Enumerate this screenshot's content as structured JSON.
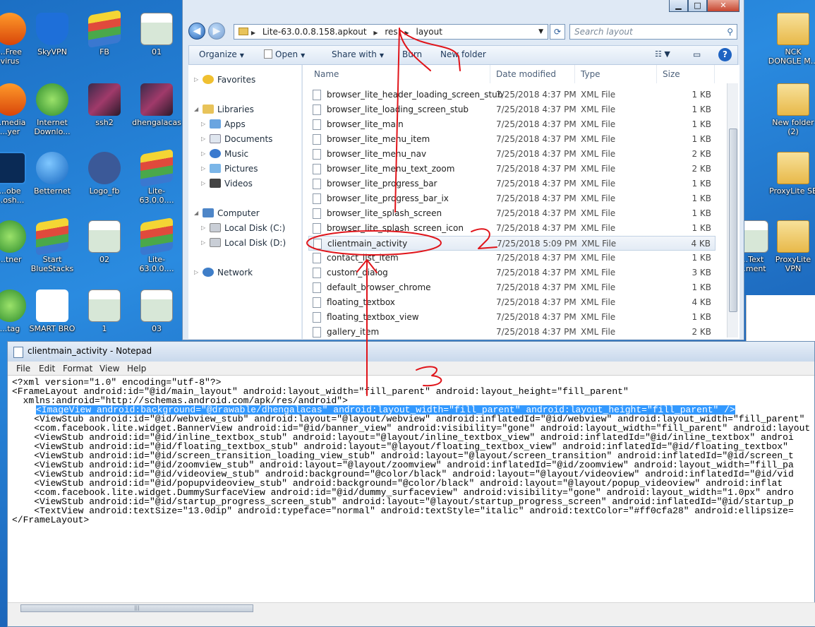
{
  "desktop": {
    "icons": [
      {
        "label": "...Free\nvirus",
        "icon": "antivirus-icon"
      },
      {
        "label": "SkyVPN",
        "icon": "vpn-shield-icon"
      },
      {
        "label": "FB",
        "icon": "bluestacks-icon"
      },
      {
        "label": "01",
        "icon": "screenshot-icon"
      },
      {
        "label": "...media\n...yer",
        "icon": "vlc-icon"
      },
      {
        "label": "Internet\nDownlo...",
        "icon": "idm-icon"
      },
      {
        "label": "ssh2",
        "icon": "photo-icon"
      },
      {
        "label": "dhengalacas",
        "icon": "photo-icon"
      },
      {
        "label": "...obe\n...osh...",
        "icon": "photoshop-icon"
      },
      {
        "label": "Betternet",
        "icon": "betternet-icon"
      },
      {
        "label": "Logo_fb",
        "icon": "facebook-icon"
      },
      {
        "label": "Lite-63.0.0....",
        "icon": "bluestacks-icon"
      },
      {
        "label": "...tner",
        "icon": "app-icon"
      },
      {
        "label": "Start\nBlueStacks",
        "icon": "bluestacks-icon"
      },
      {
        "label": "02",
        "icon": "screenshot-icon"
      },
      {
        "label": "Lite-63.0.0....",
        "icon": "bluestacks-icon"
      },
      {
        "label": "...tag",
        "icon": "app-icon"
      },
      {
        "label": "SMART BRO",
        "icon": "smartbro-icon"
      },
      {
        "label": "1",
        "icon": "screenshot-icon"
      },
      {
        "label": "03",
        "icon": "screenshot-icon"
      },
      {
        "label": "NCK\nDONGLE M...",
        "icon": "folder-icon"
      },
      {
        "label": "New folder\n(2)",
        "icon": "folder-icon"
      },
      {
        "label": "ProxyLite SE",
        "icon": "folder-icon"
      },
      {
        "label": "ProxyLite\nVPN",
        "icon": "folder-icon"
      },
      {
        "label": "...Text\n...ment",
        "icon": "text-icon"
      }
    ]
  },
  "explorer": {
    "window_controls": {
      "minimize": "▁",
      "maximize": "□",
      "close": "✕"
    },
    "breadcrumb": [
      "Lite-63.0.0.8.158.apkout",
      "res",
      "layout"
    ],
    "search_placeholder": "Search layout",
    "toolbar": {
      "organize": "Organize",
      "open": "Open",
      "share_with": "Share with",
      "burn": "Burn",
      "new_folder": "New folder"
    },
    "nav": {
      "favorites": "Favorites",
      "libraries": "Libraries",
      "apps": "Apps",
      "documents": "Documents",
      "music": "Music",
      "pictures": "Pictures",
      "videos": "Videos",
      "computer": "Computer",
      "local_c": "Local Disk (C:)",
      "local_d": "Local Disk (D:)",
      "network": "Network"
    },
    "columns": {
      "name": "Name",
      "date_modified": "Date modified",
      "type": "Type",
      "size": "Size"
    },
    "files": [
      {
        "name": "browser_lite_header_loading_screen_stub",
        "date": "7/25/2018 4:37 PM",
        "type": "XML File",
        "size": "1 KB"
      },
      {
        "name": "browser_lite_loading_screen_stub",
        "date": "7/25/2018 4:37 PM",
        "type": "XML File",
        "size": "1 KB"
      },
      {
        "name": "browser_lite_main",
        "date": "7/25/2018 4:37 PM",
        "type": "XML File",
        "size": "1 KB"
      },
      {
        "name": "browser_lite_menu_item",
        "date": "7/25/2018 4:37 PM",
        "type": "XML File",
        "size": "1 KB"
      },
      {
        "name": "browser_lite_menu_nav",
        "date": "7/25/2018 4:37 PM",
        "type": "XML File",
        "size": "2 KB"
      },
      {
        "name": "browser_lite_menu_text_zoom",
        "date": "7/25/2018 4:37 PM",
        "type": "XML File",
        "size": "2 KB"
      },
      {
        "name": "browser_lite_progress_bar",
        "date": "7/25/2018 4:37 PM",
        "type": "XML File",
        "size": "1 KB"
      },
      {
        "name": "browser_lite_progress_bar_ix",
        "date": "7/25/2018 4:37 PM",
        "type": "XML File",
        "size": "1 KB"
      },
      {
        "name": "browser_lite_splash_screen",
        "date": "7/25/2018 4:37 PM",
        "type": "XML File",
        "size": "1 KB"
      },
      {
        "name": "browser_lite_splash_screen_icon",
        "date": "7/25/2018 4:37 PM",
        "type": "XML File",
        "size": "1 KB"
      },
      {
        "name": "clientmain_activity",
        "date": "7/25/2018 5:09 PM",
        "type": "XML File",
        "size": "4 KB",
        "selected": true
      },
      {
        "name": "contact_list_item",
        "date": "7/25/2018 4:37 PM",
        "type": "XML File",
        "size": "1 KB"
      },
      {
        "name": "custom_dialog",
        "date": "7/25/2018 4:37 PM",
        "type": "XML File",
        "size": "3 KB"
      },
      {
        "name": "default_browser_chrome",
        "date": "7/25/2018 4:37 PM",
        "type": "XML File",
        "size": "1 KB"
      },
      {
        "name": "floating_textbox",
        "date": "7/25/2018 4:37 PM",
        "type": "XML File",
        "size": "4 KB"
      },
      {
        "name": "floating_textbox_view",
        "date": "7/25/2018 4:37 PM",
        "type": "XML File",
        "size": "1 KB"
      },
      {
        "name": "gallery_item",
        "date": "7/25/2018 4:37 PM",
        "type": "XML File",
        "size": "2 KB"
      }
    ]
  },
  "notepad": {
    "title": "clientmain_activity - Notepad",
    "menu": [
      "File",
      "Edit",
      "Format",
      "View",
      "Help"
    ],
    "lines": [
      "<?xml version=\"1.0\" encoding=\"utf-8\"?>",
      "<FrameLayout android:id=\"@id/main_layout\" android:layout_width=\"fill_parent\" android:layout_height=\"fill_parent\"",
      "  xmlns:android=\"http://schemas.android.com/apk/res/android\">",
      "    <ImageView android:background=\"@drawable/dhengalacas\" android:layout_width=\"fill_parent\" android:layout_height=\"fill_parent\" />",
      "    <ViewStub android:id=\"@id/webview_stub\" android:layout=\"@layout/webview\" android:inflatedId=\"@id/webview\" android:layout_width=\"fill_parent\"",
      "    <com.facebook.lite.widget.BannerView android:id=\"@id/banner_view\" android:visibility=\"gone\" android:layout_width=\"fill_parent\" android:layout",
      "    <ViewStub android:id=\"@id/inline_textbox_stub\" android:layout=\"@layout/inline_textbox_view\" android:inflatedId=\"@id/inline_textbox\" androi",
      "    <ViewStub android:id=\"@id/floating_textbox_stub\" android:layout=\"@layout/floating_textbox_view\" android:inflatedId=\"@id/floating_textbox\"",
      "    <ViewStub android:id=\"@id/screen_transition_loading_view_stub\" android:layout=\"@layout/screen_transition\" android:inflatedId=\"@id/screen_t",
      "    <ViewStub android:id=\"@id/zoomview_stub\" android:layout=\"@layout/zoomview\" android:inflatedId=\"@id/zoomview\" android:layout_width=\"fill_pa",
      "    <ViewStub android:id=\"@id/videoview_stub\" android:background=\"@color/black\" android:layout=\"@layout/videoview\" android:inflatedId=\"@id/vid",
      "    <ViewStub android:id=\"@id/popupvideoview_stub\" android:background=\"@color/black\" android:layout=\"@layout/popup_videoview\" android:inflat",
      "    <com.facebook.lite.widget.DummySurfaceView android:id=\"@id/dummy_surfaceview\" android:visibility=\"gone\" android:layout_width=\"1.0px\" andro",
      "    <ViewStub android:id=\"@id/startup_progress_screen_stub\" android:layout=\"@layout/startup_progress_screen\" android:inflatedId=\"@id/startup_p",
      "    <TextView android:textSize=\"13.0dip\" android:typeface=\"normal\" android:textStyle=\"italic\" android:textColor=\"#ff0cfa28\" android:ellipsize=",
      "</FrameLayout>"
    ],
    "selected_line": 3,
    "scroll_glyph": "|||"
  },
  "annotations": {
    "marks": [
      "2",
      "3"
    ],
    "color": "#e0141a"
  }
}
